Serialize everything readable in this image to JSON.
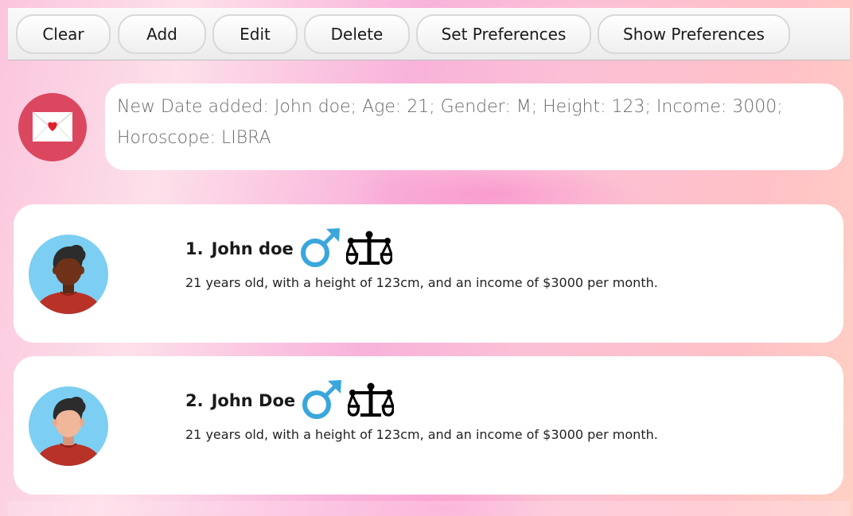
{
  "toolbar": {
    "buttons": [
      {
        "label": "Clear"
      },
      {
        "label": "Add"
      },
      {
        "label": "Edit"
      },
      {
        "label": "Delete"
      },
      {
        "label": "Set Preferences"
      },
      {
        "label": "Show Preferences"
      }
    ]
  },
  "result": {
    "icon": "envelope-heart-icon",
    "message": "New Date added: John doe; Age: 21; Gender: M; Height: 123; Income: 3000; Horoscope: LIBRA"
  },
  "dates": [
    {
      "index": "1.",
      "name": "John doe",
      "gender_icon": "male-icon",
      "horoscope_icon": "libra-icon",
      "avatar": "dark-skin-avatar",
      "description": "21 years old, with a height of 123cm, and an income of $3000 per month."
    },
    {
      "index": "2.",
      "name": "John Doe",
      "gender_icon": "male-icon",
      "horoscope_icon": "libra-icon",
      "avatar": "light-skin-avatar",
      "description": "21 years old, with a height of 123cm, and an income of $3000 per month."
    }
  ],
  "colors": {
    "male_icon": "#3aa6dc",
    "message_icon_bg": "#dc4760",
    "avatar_bg": "#7ccff2",
    "shirt": "#b83228"
  }
}
